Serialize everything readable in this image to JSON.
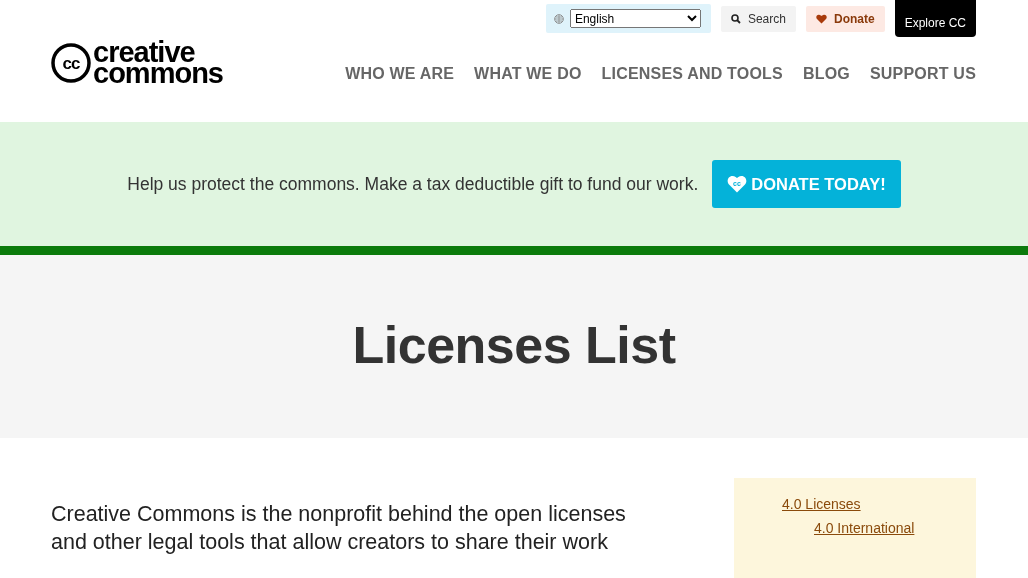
{
  "utility_bar": {
    "language": {
      "value": "English"
    },
    "search_button": "Search",
    "donate_button": "Donate",
    "explore_button": "Explore CC"
  },
  "logo": {
    "mark": "cc",
    "line_1": "creative",
    "line_2": "commons"
  },
  "nav": [
    "WHO WE ARE",
    "WHAT WE DO",
    "LICENSES AND TOOLS",
    "BLOG",
    "SUPPORT US"
  ],
  "banner": {
    "text": "Help us protect the commons. Make a tax deductible gift to fund our work.",
    "button": "DONATE TODAY!",
    "button_mark": "cc"
  },
  "page_title": "Licenses List",
  "intro": "Creative Commons is the nonprofit behind the open licenses and other legal tools that allow creators to share their work",
  "toc": [
    {
      "label": "4.0 Licenses",
      "children": [
        {
          "label": "4.0 International"
        }
      ]
    }
  ]
}
